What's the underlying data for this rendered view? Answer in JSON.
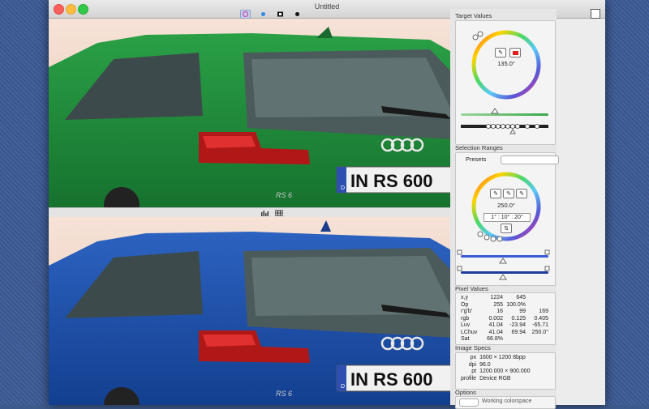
{
  "window": {
    "title": "Untitled"
  },
  "colors": {
    "accent_red": "#e12020",
    "car_top": "#1f8c3a",
    "car_bottom": "#1c4ea6"
  },
  "toolbar": {
    "icons": [
      "color-wheel-icon",
      "dot-icon",
      "square-icon",
      "dot-icon",
      "layout-icon"
    ]
  },
  "image": {
    "plate_text": "IN RS 600",
    "plate_prefix": "D",
    "badge": "RS 6"
  },
  "target": {
    "title": "Target Values",
    "angle": "135.0°"
  },
  "selection": {
    "title": "Selection Ranges",
    "presets_label": "Presets",
    "presets_value": "",
    "angle": "250.0°",
    "range": "1° : 10° : 20°",
    "swap": "⇅"
  },
  "pixel": {
    "title": "Pixel Values",
    "rows": [
      [
        "x,y",
        "1224",
        "645",
        ""
      ],
      [
        "Op",
        "255",
        "100.0%",
        ""
      ],
      [
        "r'g'b'",
        "16",
        "99",
        "169"
      ],
      [
        "rgb",
        "0.002",
        "0.125",
        "0.405"
      ],
      [
        "Luv",
        "41.04",
        "-23.94",
        "-65.71"
      ],
      [
        "LChuv",
        "41.04",
        "69.94",
        "250.0°"
      ],
      [
        "Sat",
        "66.8%",
        "",
        ""
      ]
    ]
  },
  "specs": {
    "title": "Image Specs",
    "rows": [
      [
        "px",
        "1600 × 1200 8bpp"
      ],
      [
        "dpi",
        "96.0"
      ],
      [
        "pt",
        "1200.000 × 900.000"
      ],
      [
        "profile",
        "Device RGB"
      ]
    ]
  },
  "options": {
    "title": "Options",
    "trailing": "Working colorspace"
  }
}
